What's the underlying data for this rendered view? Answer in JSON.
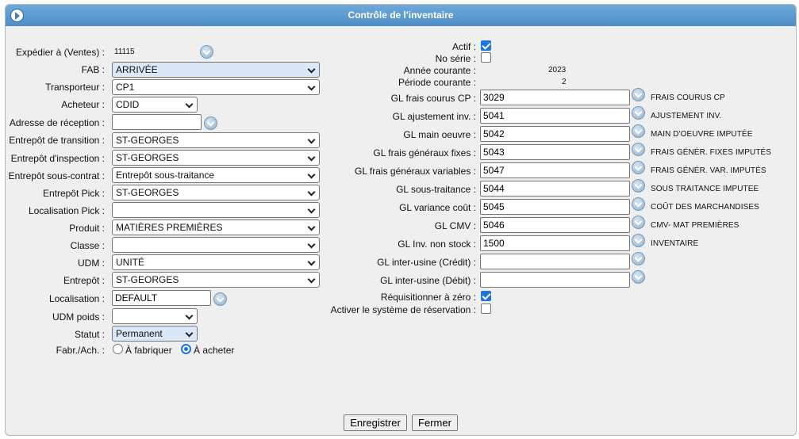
{
  "title": "Contrôle de l'inventaire",
  "left": {
    "expedier": {
      "label": "Expédier à (Ventes) :",
      "value": "11115"
    },
    "fab": {
      "label": "FAB :",
      "value": "ARRIVÉE"
    },
    "transporteur": {
      "label": "Transporteur :",
      "value": "CP1"
    },
    "acheteur": {
      "label": "Acheteur :",
      "value": "CDID"
    },
    "adresse_reception": {
      "label": "Adresse de réception :",
      "value": ""
    },
    "entrepot_transition": {
      "label": "Entrepôt de transition :",
      "value": "ST-GEORGES"
    },
    "entrepot_inspection": {
      "label": "Entrepôt d'inspection :",
      "value": "ST-GEORGES"
    },
    "entrepot_sous_contrat": {
      "label": "Entrepôt sous-contrat :",
      "value": "Entrepôt sous-traitance"
    },
    "entrepot_pick": {
      "label": "Entrepôt Pick :",
      "value": "ST-GEORGES"
    },
    "localisation_pick": {
      "label": "Localisation Pick :",
      "value": ""
    },
    "produit": {
      "label": "Produit :",
      "value": "MATIÈRES PREMIÈRES"
    },
    "classe": {
      "label": "Classe :",
      "value": ""
    },
    "udm": {
      "label": "UDM :",
      "value": "UNITÉ"
    },
    "entrepot": {
      "label": "Entrepôt :",
      "value": "ST-GEORGES"
    },
    "localisation": {
      "label": "Localisation :",
      "value": "DEFAULT"
    },
    "udm_poids": {
      "label": "UDM poids :",
      "value": ""
    },
    "statut": {
      "label": "Statut :",
      "value": "Permanent"
    },
    "fabr_ach": {
      "label": "Fabr./Ach. :",
      "option_fabriquer": "À fabriquer",
      "option_acheter": "À acheter",
      "selected": "À acheter"
    }
  },
  "right": {
    "actif": {
      "label": "Actif :",
      "checked": true
    },
    "no_serie": {
      "label": "No série :",
      "checked": false
    },
    "annee_courante": {
      "label": "Année courante :",
      "value": "2023"
    },
    "periode_courante": {
      "label": "Période courante :",
      "value": "2"
    },
    "gl_accounts": [
      {
        "label": "GL frais courus CP :",
        "value": "3029",
        "desc": "FRAIS COURUS CP"
      },
      {
        "label": "GL ajustement inv. :",
        "value": "5041",
        "desc": "AJUSTEMENT INV."
      },
      {
        "label": "GL main oeuvre :",
        "value": "5042",
        "desc": "MAIN D'OEUVRE IMPUTÉE"
      },
      {
        "label": "GL frais généraux fixes :",
        "value": "5043",
        "desc": "FRAIS GÉNÉR. FIXES IMPUTÉS"
      },
      {
        "label": "GL frais généraux variables :",
        "value": "5047",
        "desc": "FRAIS GÉNÉR. VAR. IMPUTÉS"
      },
      {
        "label": "GL sous-traitance :",
        "value": "5044",
        "desc": "SOUS TRAITANCE IMPUTEE"
      },
      {
        "label": "GL variance coût :",
        "value": "5045",
        "desc": "COÛT DES MARCHANDISES"
      },
      {
        "label": "GL CMV :",
        "value": "5046",
        "desc": "CMV- MAT PREMIÈRES"
      },
      {
        "label": "GL Inv. non stock :",
        "value": "1500",
        "desc": "INVENTAIRE"
      },
      {
        "label": "GL inter-usine (Crédit) :",
        "value": "",
        "desc": ""
      },
      {
        "label": "GL inter-usine (Débit) :",
        "value": "",
        "desc": ""
      }
    ],
    "requisitionner": {
      "label": "Réquisitionner à zéro :",
      "checked": true
    },
    "reservation": {
      "label": "Activer le système de réservation :",
      "checked": false
    }
  },
  "buttons": {
    "save": "Enregistrer",
    "close": "Fermer"
  },
  "colors": {
    "titlebar": "#5b98cf",
    "accent": "#1a73e8",
    "select_highlight": "#dbe8f7"
  },
  "icons": {
    "title": "chevron-right-circle-icon",
    "lookup": "lookup-chevron-icon"
  }
}
